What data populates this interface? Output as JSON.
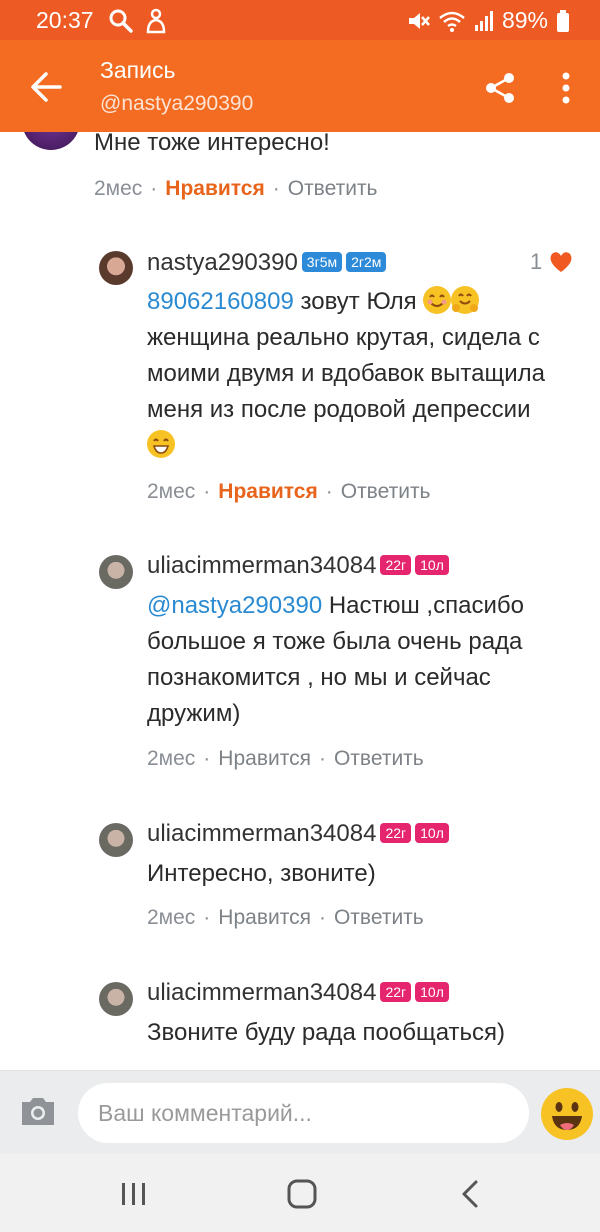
{
  "status_bar": {
    "time": "20:37",
    "battery": "89%"
  },
  "app_bar": {
    "title": "Запись",
    "subtitle": "@nastya290390"
  },
  "comments": [
    {
      "text": "Мне тоже интересно!",
      "time": "2мес",
      "like": "Нравится",
      "reply": "Ответить",
      "liked": true
    },
    {
      "username": "nastya290390",
      "badges": [
        "3г5м",
        "2г2м"
      ],
      "badge_color": "#2c8ad8",
      "likes_count": "1",
      "mention": "89062160809",
      "line1": " зовут Юля",
      "line2": "женщина реально крутая, сидела с",
      "line3": "моими двумя и вдобавок вытащила",
      "line4": "меня из после родовой депрессии",
      "time": "2мес",
      "like": "Нравится",
      "reply": "Ответить",
      "liked": true
    },
    {
      "username": "uliacimmerman34084",
      "badges": [
        "22г",
        "10л"
      ],
      "badge_color": "#e5256e",
      "mention": "@nastya290390",
      "line1": " Настюш ,спасибо",
      "line2": "большое я тоже была очень рада",
      "line3": "познакомится  , но мы и сейчас",
      "line4": "дружим)",
      "time": "2мес",
      "like": "Нравится",
      "reply": "Ответить",
      "liked": false
    },
    {
      "username": "uliacimmerman34084",
      "badges": [
        "22г",
        "10л"
      ],
      "text": "Интересно, звоните)",
      "time": "2мес",
      "like": "Нравится",
      "reply": "Ответить",
      "liked": false
    },
    {
      "username": "uliacimmerman34084",
      "badges": [
        "22г",
        "10л"
      ],
      "text": "Звоните буду рада пообщаться)"
    }
  ],
  "composer": {
    "placeholder": "Ваш комментарий..."
  },
  "colors": {
    "accent": "#f36c21",
    "status": "#ee5a23",
    "link": "#2a8ad1",
    "liked": "#e8641c"
  }
}
